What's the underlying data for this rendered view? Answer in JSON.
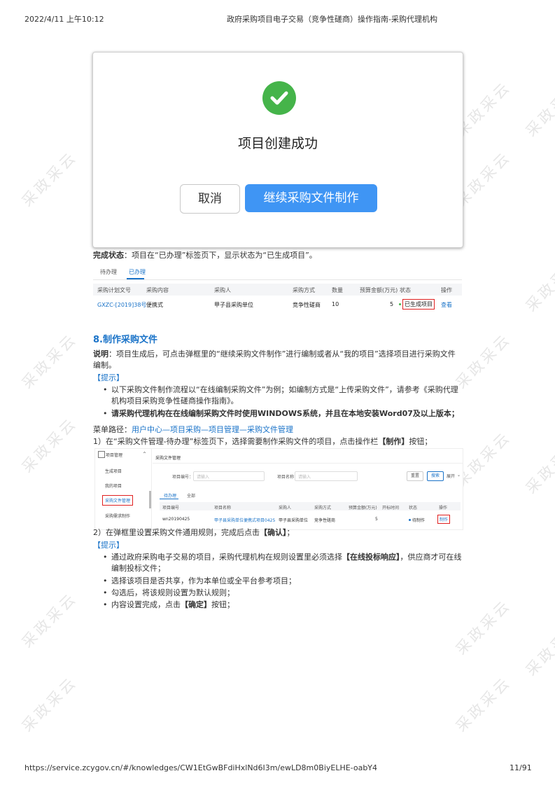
{
  "header": {
    "datetime": "2022/4/11 上午10:12",
    "title": "政府采购项目电子交易（竞争性磋商）操作指南-采购代理机构"
  },
  "watermark": "采政采云",
  "modal": {
    "title": "项目创建成功",
    "cancel_label": "取消",
    "primary_label": "继续采购文件制作",
    "success_color": "#45b44a",
    "primary_color": "#3f95f4"
  },
  "status_note": {
    "label": "完成状态",
    "text": "：项目在“已办理”标签页下，显示状态为“已生成项目”。"
  },
  "table1": {
    "tabs": [
      "待办理",
      "已办理"
    ],
    "headers": [
      "采购计划文号",
      "采购内容",
      "采购人",
      "采购方式",
      "数量",
      "预算金额(万元)",
      "状态",
      "操作"
    ],
    "row": [
      "GXZC-[2019]38号",
      "便携式",
      "甲子县采购单位",
      "竞争性磋商",
      "10",
      "5",
      "已生成项目",
      "查看"
    ]
  },
  "section8": {
    "title": "8.制作采购文件",
    "desc_label": "说明",
    "desc_text": "：项目生成后，可点击弹框里的“继续采购文件制作”进行编制或者从“我的项目”选择项目进行采购文件编制。",
    "tip_label": "【提示】",
    "tips": [
      "以下采购文件制作流程以“在线编制采购文件”为例；如编制方式是“上传采购文件”，请参考《采购代理机构项目采购竞争性磋商操作指南》。",
      "请采购代理机构在在线编制采购文件时使用WINDOWS系统，并且在本地安装Word07及以上版本；"
    ],
    "menu_label": "菜单路径：",
    "menu_path": "用户中心—项目采购—项目管理—采购文件管理",
    "step1_pre": "1）在“采购文件管理-待办理”标签页下，选择需要制作采购文件的项目，点击操作栏",
    "step1_bold": "【制作】",
    "step1_post": "按钮；",
    "step2_pre": "2）在弹框里设置采购文件通用规则，完成后点击",
    "step2_bold": "【确认】",
    "step2_post": "；",
    "tip2_label": "【提示】",
    "tips2": [
      {
        "pre": "通过政府采购电子交易的项目，采购代理机构在规则设置里必须选择",
        "bold": "【在线投标响应】",
        "post": "，供应商才可在线编制投标文件；"
      },
      {
        "pre": "选择该项目是否共享，作为本单位或全平台参考项目；",
        "bold": "",
        "post": ""
      },
      {
        "pre": "勾选后，将该规则设置为默认规则；",
        "bold": "",
        "post": ""
      },
      {
        "pre": "内容设置完成，点击",
        "bold": "【确定】",
        "post": "按钮；"
      }
    ]
  },
  "shot2": {
    "sidebar_title": "项目管理",
    "sidebar_items": [
      "生成项目",
      "我的项目",
      "采购文件管理",
      "采购需求制作"
    ],
    "page_title": "采购文件管理",
    "field1_label": "项目编号：",
    "field1_placeholder": "请输入",
    "field2_label": "项目名称：",
    "field2_placeholder": "请输入",
    "reset_label": "重置",
    "search_label": "搜索",
    "expand_label": "展开",
    "tabs": [
      "待办理",
      "全部"
    ],
    "headers": [
      "项目编号",
      "项目名称",
      "采购人",
      "采购方式",
      "预算金额(万元)",
      "开标时间",
      "状态",
      "操作"
    ],
    "row": [
      "wn20190425",
      "甲子县采购单位便携式项目0425",
      "甲子县采购单位",
      "竞争性磋商",
      "5",
      "",
      "待制作",
      "制作"
    ]
  },
  "footer": {
    "url": "https://service.zcygov.cn/#/knowledges/CW1EtGwBFdiHxlNd6I3m/ewLD8m0BiyELHE-oabY4",
    "page": "11/91"
  }
}
